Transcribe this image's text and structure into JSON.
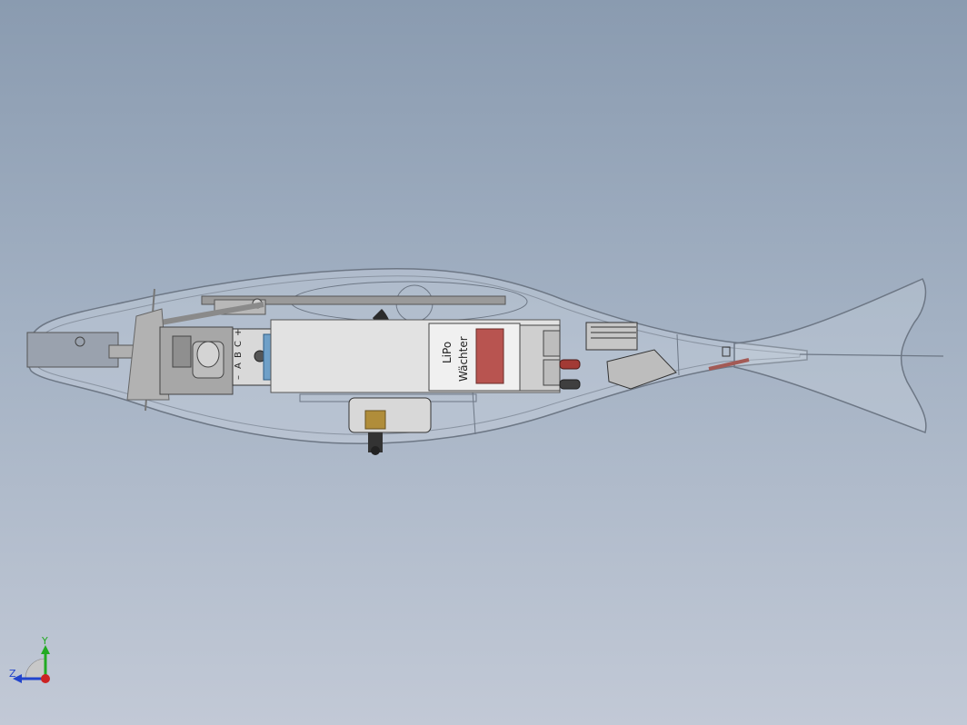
{
  "viewport": {
    "background_top": "#8a9bb0",
    "background_bottom": "#c2c9d6"
  },
  "model": {
    "lipo_label": "LiPo",
    "waechter_label": "Wächter",
    "controller_letters": [
      "A",
      "B",
      "C"
    ],
    "controller_minus": "–",
    "controller_plus": "+",
    "hull_color": "#6d7785",
    "part_color": "#c9c9c9",
    "indicator_color": "#b85450",
    "propeller_color": "#2b2b2b",
    "shaft_color": "#b08d3a"
  },
  "triad": {
    "y_label": "Y",
    "z_label": "Z",
    "y_color": "#22aa22",
    "z_color": "#2244cc",
    "x_color": "#cc2222"
  }
}
